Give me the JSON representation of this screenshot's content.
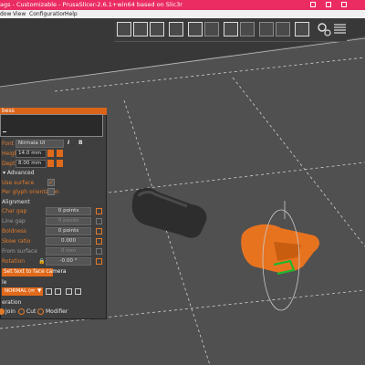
{
  "titlebar": {
    "title": "ags - Customizable - PrusaSlicer-2.6.1+win64 based on Slic3r"
  },
  "menubar": {
    "items": [
      "dow",
      "View",
      "Configuration",
      "Help"
    ]
  },
  "toolbar": {
    "icons": [
      "add-object-icon",
      "delete-icon",
      "delete-all-icon",
      "arrange-icon",
      "copy-icon",
      "paste-icon",
      "add-instance-icon",
      "remove-instance-icon",
      "split-objects-icon",
      "split-parts-icon",
      "variable-layer-height-icon",
      "search-icon",
      "settings-icon",
      "layers-icon"
    ]
  },
  "panel": {
    "header": "bess",
    "textbox_value": "",
    "font": {
      "label": "Font",
      "value": "Nirmala UI",
      "italic_btn": "I",
      "bold_btn": "B"
    },
    "height": {
      "label": "Height",
      "value": "14.0 mm"
    },
    "depth": {
      "label": "Depth",
      "value": "8.00 mm"
    },
    "advanced": {
      "label": "Advanced"
    },
    "use_surface": {
      "label": "Use surface",
      "checked": true
    },
    "per_glyph": {
      "label": "Per glyph orientation",
      "checked": false
    },
    "alignment": {
      "label": "Alignment"
    },
    "char_gap": {
      "label": "Char gap",
      "value": "0 points"
    },
    "line_gap": {
      "label": "Line gap",
      "value": "0 points"
    },
    "boldness": {
      "label": "Boldness",
      "value": "0 points"
    },
    "skew_ratio": {
      "label": "Skew ratio",
      "value": "0.000"
    },
    "from_surface": {
      "label": "From surface",
      "value": "0 mm"
    },
    "rotation": {
      "label": "Rotation",
      "value": "-0.00 °"
    },
    "face_camera_button": "Set text to face camera",
    "style": {
      "label": "le",
      "value": "NORMAL (modifie",
      "dropdown_btn": "▼"
    },
    "operation": {
      "label": "eration",
      "options": [
        "Join",
        "Cut",
        "Modifier"
      ],
      "selected": "Join"
    }
  },
  "colors": {
    "accent": "#e06a1c",
    "title": "#ea2c62",
    "object_orange": "#e8731f",
    "object_dark": "#2e2e2e"
  }
}
